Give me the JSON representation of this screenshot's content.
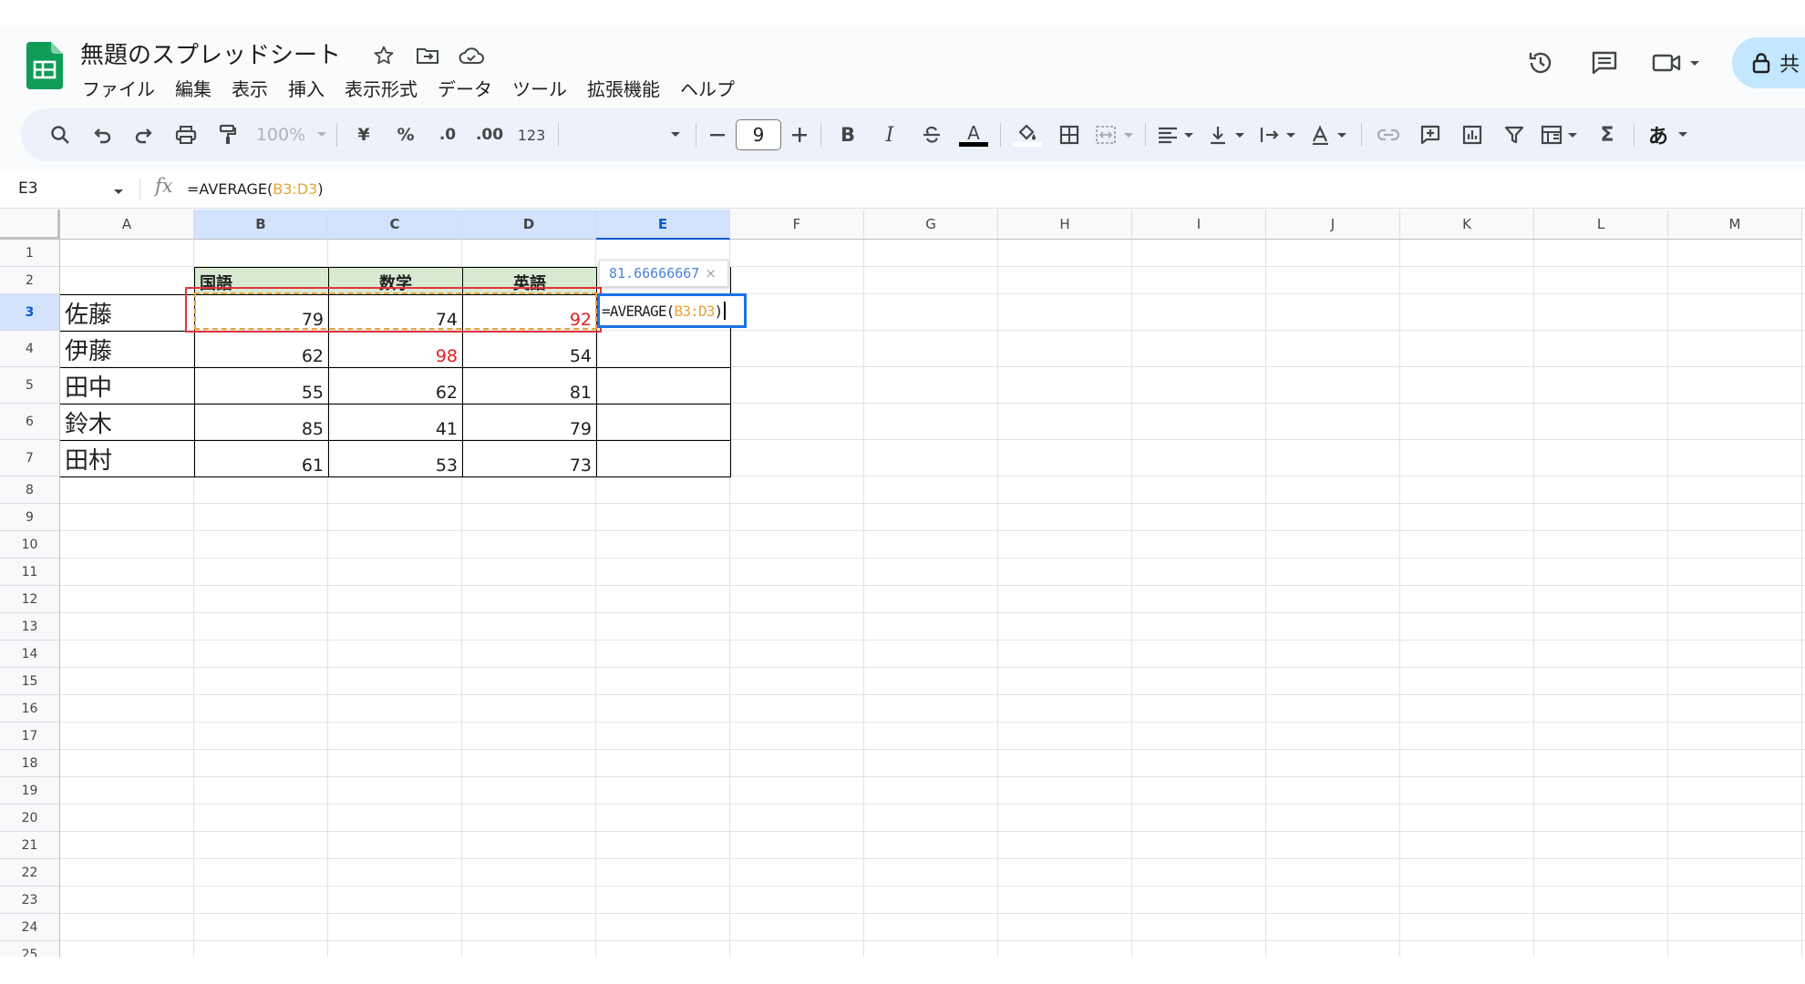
{
  "app": {
    "doc_title": "無題のスプレッドシート",
    "menu": [
      "ファイル",
      "編集",
      "表示",
      "挿入",
      "表示形式",
      "データ",
      "ツール",
      "拡張機能",
      "ヘルプ"
    ],
    "share_label": "共",
    "brand_color": "#0f9d58"
  },
  "toolbar": {
    "zoom": "100%",
    "currency": "¥",
    "percent": "%",
    "decimal_decrease": ".0",
    "decimal_increase": ".00",
    "number_format": "123",
    "font_size": "9",
    "bold": "B",
    "italic": "I",
    "text_color_letter": "A",
    "input_tools": "あ",
    "sum": "Σ"
  },
  "formula_bar": {
    "name_box": "E3",
    "fx": "fx",
    "formula_prefix": "=AVERAGE(",
    "formula_ref": "B3:D3",
    "formula_suffix": ")"
  },
  "grid": {
    "columns": [
      "A",
      "B",
      "C",
      "D",
      "E",
      "F",
      "G",
      "H",
      "I",
      "J",
      "K",
      "L",
      "M"
    ],
    "selected_column": "E",
    "rows": [
      "1",
      "2",
      "3",
      "4",
      "5",
      "6",
      "7",
      "8",
      "9",
      "10",
      "11",
      "12",
      "13",
      "14",
      "15",
      "16",
      "17",
      "18",
      "19",
      "20",
      "21",
      "22",
      "23",
      "24",
      "25"
    ],
    "selected_row": "3",
    "subject_headers": [
      "国語",
      "数学",
      "英語"
    ],
    "students": [
      {
        "name": "佐藤",
        "scores": [
          "79",
          "74",
          "92"
        ]
      },
      {
        "name": "伊藤",
        "scores": [
          "62",
          "98",
          "54"
        ]
      },
      {
        "name": "田中",
        "scores": [
          "55",
          "62",
          "81"
        ]
      },
      {
        "name": "鈴木",
        "scores": [
          "85",
          "41",
          "79"
        ]
      },
      {
        "name": "田村",
        "scores": [
          "61",
          "53",
          "73"
        ]
      }
    ],
    "highlight_color": "#e42121",
    "header_fill": "#d9ead3"
  },
  "editor": {
    "preview_value": "81.66666667",
    "preview_close": "×",
    "edit_prefix": "=AVERAGE(",
    "edit_ref": "B3:D3",
    "edit_suffix": ")"
  }
}
